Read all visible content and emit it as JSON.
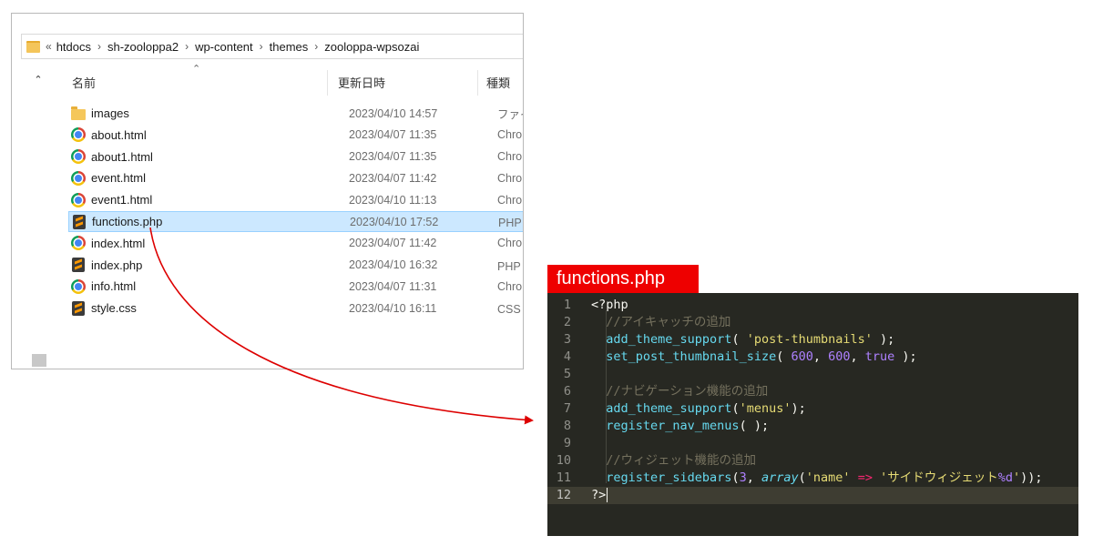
{
  "explorer": {
    "breadcrumb": {
      "overflow": "«",
      "parts": [
        "htdocs",
        "sh-zooloppa2",
        "wp-content",
        "themes",
        "zooloppa-wpsozai"
      ],
      "separator": "›"
    },
    "columns": {
      "name": "名前",
      "date": "更新日時",
      "type": "種類"
    },
    "files": [
      {
        "name": "images",
        "date": "2023/04/10 14:57",
        "type": "ファイル",
        "icon": "folder-icon"
      },
      {
        "name": "about.html",
        "date": "2023/04/07 11:35",
        "type": "Chrome",
        "icon": "chrome-icon"
      },
      {
        "name": "about1.html",
        "date": "2023/04/07 11:35",
        "type": "Chrome",
        "icon": "chrome-icon"
      },
      {
        "name": "event.html",
        "date": "2023/04/07 11:42",
        "type": "Chrome",
        "icon": "chrome-icon"
      },
      {
        "name": "event1.html",
        "date": "2023/04/10 11:13",
        "type": "Chrome",
        "icon": "chrome-icon"
      },
      {
        "name": "functions.php",
        "date": "2023/04/10 17:52",
        "type": "PHP フ",
        "icon": "sublime-icon",
        "selected": true
      },
      {
        "name": "index.html",
        "date": "2023/04/07 11:42",
        "type": "Chrome",
        "icon": "chrome-icon"
      },
      {
        "name": "index.php",
        "date": "2023/04/10 16:32",
        "type": "PHP フ",
        "icon": "sublime-icon"
      },
      {
        "name": "info.html",
        "date": "2023/04/07 11:31",
        "type": "Chrome",
        "icon": "chrome-icon"
      },
      {
        "name": "style.css",
        "date": "2023/04/10 16:11",
        "type": "CSS フ",
        "icon": "sublime-icon"
      }
    ]
  },
  "editor": {
    "title": "functions.php",
    "current_line": 12,
    "lines": [
      {
        "n": "1",
        "tokens": [
          {
            "t": "<?php",
            "c": ""
          }
        ]
      },
      {
        "n": "2",
        "tokens": [
          {
            "t": "  //アイキャッチの追加",
            "c": "c-comment"
          }
        ]
      },
      {
        "n": "3",
        "tokens": [
          {
            "t": "  ",
            "c": ""
          },
          {
            "t": "add_theme_support",
            "c": "c-fn"
          },
          {
            "t": "( ",
            "c": ""
          },
          {
            "t": "'post-thumbnails'",
            "c": "c-str"
          },
          {
            "t": " );",
            "c": ""
          }
        ]
      },
      {
        "n": "4",
        "tokens": [
          {
            "t": "  ",
            "c": ""
          },
          {
            "t": "set_post_thumbnail_size",
            "c": "c-fn"
          },
          {
            "t": "( ",
            "c": ""
          },
          {
            "t": "600",
            "c": "c-num"
          },
          {
            "t": ", ",
            "c": ""
          },
          {
            "t": "600",
            "c": "c-num"
          },
          {
            "t": ", ",
            "c": ""
          },
          {
            "t": "true",
            "c": "c-num"
          },
          {
            "t": " );",
            "c": ""
          }
        ]
      },
      {
        "n": "5",
        "tokens": []
      },
      {
        "n": "6",
        "tokens": [
          {
            "t": "  //ナビゲーション機能の追加",
            "c": "c-comment"
          }
        ]
      },
      {
        "n": "7",
        "tokens": [
          {
            "t": "  ",
            "c": ""
          },
          {
            "t": "add_theme_support",
            "c": "c-fn"
          },
          {
            "t": "(",
            "c": ""
          },
          {
            "t": "'menus'",
            "c": "c-str"
          },
          {
            "t": ");",
            "c": ""
          }
        ]
      },
      {
        "n": "8",
        "tokens": [
          {
            "t": "  ",
            "c": ""
          },
          {
            "t": "register_nav_menus",
            "c": "c-fn"
          },
          {
            "t": "( );",
            "c": ""
          }
        ]
      },
      {
        "n": "9",
        "tokens": []
      },
      {
        "n": "10",
        "tokens": [
          {
            "t": "  //ウィジェット機能の追加",
            "c": "c-comment"
          }
        ]
      },
      {
        "n": "11",
        "tokens": [
          {
            "t": "  ",
            "c": ""
          },
          {
            "t": "register_sidebars",
            "c": "c-fn"
          },
          {
            "t": "(",
            "c": ""
          },
          {
            "t": "3",
            "c": "c-num"
          },
          {
            "t": ", ",
            "c": ""
          },
          {
            "t": "array",
            "c": "c-kw"
          },
          {
            "t": "(",
            "c": ""
          },
          {
            "t": "'name'",
            "c": "c-str"
          },
          {
            "t": " ",
            "c": ""
          },
          {
            "t": "=>",
            "c": "c-op"
          },
          {
            "t": " ",
            "c": ""
          },
          {
            "t": "'サイドウィジェット",
            "c": "c-str"
          },
          {
            "t": "%d",
            "c": "c-num"
          },
          {
            "t": "'",
            "c": "c-str"
          },
          {
            "t": "));",
            "c": ""
          }
        ]
      },
      {
        "n": "12",
        "tokens": [
          {
            "t": "?>",
            "c": ""
          }
        ]
      }
    ]
  },
  "colors": {
    "title_bg": "#ee0000",
    "editor_bg": "#272822",
    "arrow": "#dd0000",
    "selection": "#cce8ff"
  }
}
